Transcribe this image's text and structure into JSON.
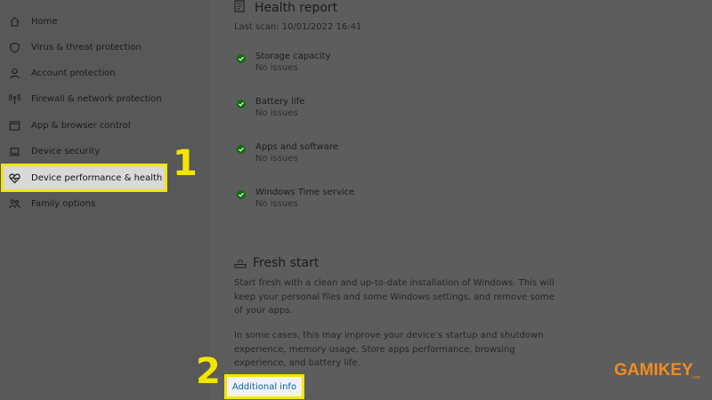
{
  "sidebar": {
    "items": [
      {
        "label": "Home",
        "icon": "home-icon"
      },
      {
        "label": "Virus & threat protection",
        "icon": "shield-icon"
      },
      {
        "label": "Account protection",
        "icon": "person-icon"
      },
      {
        "label": "Firewall & network protection",
        "icon": "antenna-icon"
      },
      {
        "label": "App & browser control",
        "icon": "browser-window-icon"
      },
      {
        "label": "Device security",
        "icon": "laptop-icon"
      },
      {
        "label": "Device performance & health",
        "icon": "heart-pulse-icon",
        "active": true
      },
      {
        "label": "Family options",
        "icon": "family-icon"
      }
    ]
  },
  "health_report": {
    "title": "Health report",
    "last_scan": "Last scan: 10/01/2022 16:41",
    "items": [
      {
        "name": "Storage capacity",
        "status": "No issues"
      },
      {
        "name": "Battery life",
        "status": "No issues"
      },
      {
        "name": "Apps and software",
        "status": "No issues"
      },
      {
        "name": "Windows Time service",
        "status": "No issues"
      }
    ]
  },
  "fresh_start": {
    "title": "Fresh start",
    "para1": "Start fresh with a clean and up-to-date installation of Windows. This will keep your personal files and some Windows settings, and remove some of your apps.",
    "para2": "In some cases, this may improve your device's startup and shutdown experience, memory usage, Store apps performance, browsing experience, and battery life.",
    "link": "Additional info"
  },
  "annotations": {
    "marker1": "1",
    "marker2": "2"
  },
  "watermark": {
    "logo": "GAMIKEY",
    "sub": ".com"
  },
  "colors": {
    "highlight": "#f4e500",
    "link": "#0063b1",
    "check": "#0c6e0c",
    "logo": "#f28c1f"
  }
}
